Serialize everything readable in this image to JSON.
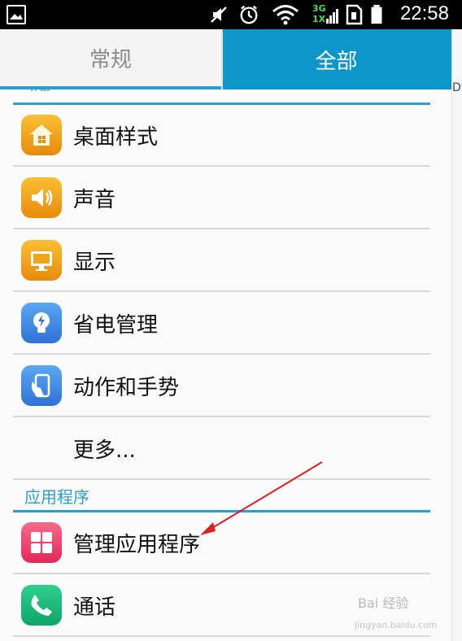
{
  "status_bar": {
    "time": "22:58",
    "network": "3G\n1X"
  },
  "tabs": [
    {
      "label": "常规",
      "selected": false
    },
    {
      "label": "全部",
      "selected": true
    }
  ],
  "edge_text": "DS",
  "top_section": {
    "header_partial": "设备"
  },
  "items_device": [
    {
      "label": "桌面样式",
      "icon": "home-icon"
    },
    {
      "label": "声音",
      "icon": "speaker-icon"
    },
    {
      "label": "显示",
      "icon": "monitor-icon"
    },
    {
      "label": "省电管理",
      "icon": "lightbulb-icon"
    },
    {
      "label": "动作和手势",
      "icon": "hand-phone-icon"
    },
    {
      "label": "更多..."
    }
  ],
  "apps_section": {
    "header": "应用程序"
  },
  "items_apps": [
    {
      "label": "管理应用程序",
      "icon": "apps-grid-icon"
    },
    {
      "label": "通话",
      "icon": "phone-icon"
    }
  ],
  "watermark": {
    "text": "Bai 经验",
    "sub": "jingyan.baidu.com"
  },
  "colors": {
    "accent": "#2a9fd6",
    "tab_selected": "#0d96c8",
    "arrow": "#e02020"
  }
}
